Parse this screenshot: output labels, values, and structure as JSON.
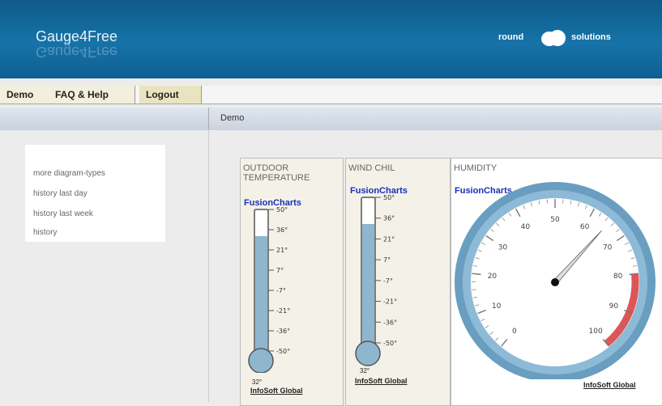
{
  "header": {
    "app_title": "Gauge4Free",
    "logo_left": "round",
    "logo_right": "solutions"
  },
  "menu": {
    "demo": "Demo",
    "faq": "FAQ & Help",
    "logout": "Logout"
  },
  "main": {
    "title": "Demo"
  },
  "sidebar": {
    "items": [
      {
        "label": "more diagram-types"
      },
      {
        "label": "history last day"
      },
      {
        "label": "history last week"
      },
      {
        "label": "history"
      }
    ]
  },
  "gauges": {
    "outdoor": {
      "title_line1": "OUTDOOR",
      "title_line2": "TEMPERATURE",
      "brand": "FusionCharts",
      "credit": "InfoSoft Global",
      "reading": "32°",
      "ticks": [
        "50°",
        "36°",
        "21°",
        "7°",
        "-7°",
        "-21°",
        "-36°",
        "-50°"
      ],
      "value": 32
    },
    "wind": {
      "title": "WIND CHIL",
      "brand": "FusionCharts",
      "credit": "InfoSoft Global",
      "reading": "32°",
      "ticks": [
        "50°",
        "36°",
        "21°",
        "7°",
        "-7°",
        "-21°",
        "-36°",
        "-50°"
      ],
      "value": 32
    },
    "humidity": {
      "title": "HUMIDITY",
      "brand": "FusionCharts",
      "credit": "InfoSoft Global",
      "scale": [
        "0",
        "10",
        "20",
        "30",
        "40",
        "50",
        "60",
        "70",
        "80",
        "90",
        "100"
      ],
      "value": 65
    }
  },
  "colors": {
    "header": "#1673a8",
    "mercury": "#8fb6cf",
    "humidity_bezel": "#6a9ec0",
    "humidity_red": "#e05555",
    "brand_text": "#1a2fb8"
  }
}
